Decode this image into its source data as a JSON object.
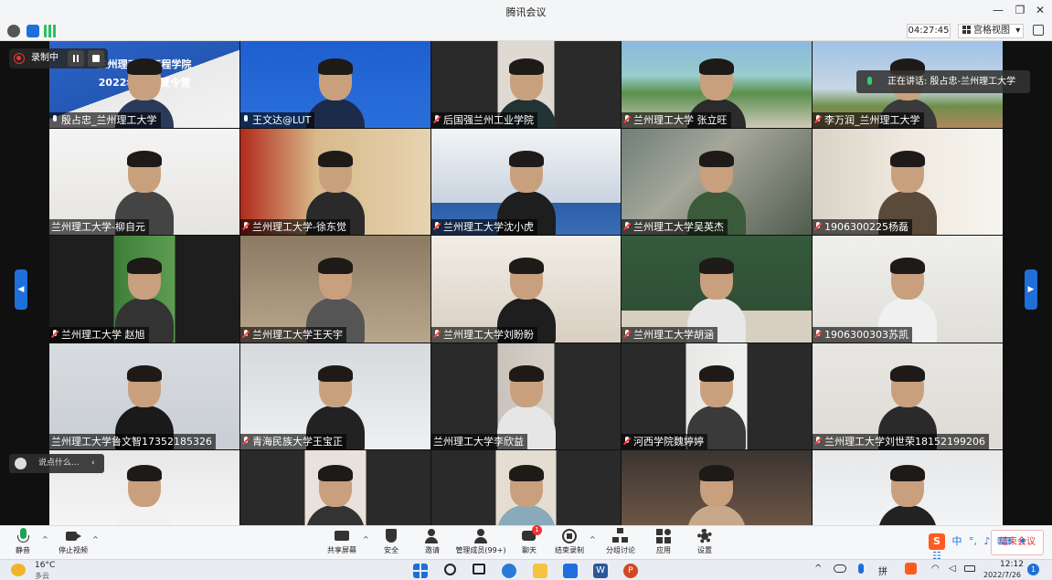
{
  "window": {
    "title": "腾讯会议",
    "minimize": "—",
    "maximize": "❐",
    "close": "✕"
  },
  "topbar": {
    "timer": "04:27:45",
    "view_label": "宫格视图",
    "view_caret": "▾"
  },
  "recording": {
    "label": "录制中"
  },
  "speaking_banner": "正在讲话: 殷占忠-兰州理工大学",
  "chat_input": {
    "placeholder": "说点什么..."
  },
  "participants": [
    {
      "name": "殷占忠_兰州理工大学",
      "mic": "on"
    },
    {
      "name": "王文达@LUT",
      "mic": "on"
    },
    {
      "name": "后国强兰州工业学院",
      "mic": "off"
    },
    {
      "name": "兰州理工大学 张立旺",
      "mic": "off"
    },
    {
      "name": "李万润_兰州理工大学",
      "mic": "off"
    },
    {
      "name": "兰州理工大学-柳自元",
      "mic": "none"
    },
    {
      "name": "兰州理工大学-徐东觉",
      "mic": "off"
    },
    {
      "name": "兰州理工大学沈小虎",
      "mic": "off"
    },
    {
      "name": "兰州理工大学吴英杰",
      "mic": "off"
    },
    {
      "name": "1906300225杨磊",
      "mic": "off"
    },
    {
      "name": "兰州理工大学 赵旭",
      "mic": "off"
    },
    {
      "name": "兰州理工大学王天宇",
      "mic": "off"
    },
    {
      "name": "兰州理工大学刘盼盼",
      "mic": "off"
    },
    {
      "name": "兰州理工大学胡涵",
      "mic": "off"
    },
    {
      "name": "1906300303苏凯",
      "mic": "off"
    },
    {
      "name": "兰州理工大学鲁文智17352185326",
      "mic": "none"
    },
    {
      "name": "青海民族大学王宝正",
      "mic": "off"
    },
    {
      "name": "兰州理工大学李欣益",
      "mic": "none"
    },
    {
      "name": "河西学院魏婷婷",
      "mic": "off"
    },
    {
      "name": "兰州理工大学刘世荣18152199206",
      "mic": "off"
    },
    {
      "name": "",
      "mic": "none"
    },
    {
      "name": "",
      "mic": "none"
    },
    {
      "name": "",
      "mic": "none"
    },
    {
      "name": "",
      "mic": "none"
    },
    {
      "name": "",
      "mic": "none"
    }
  ],
  "banner_slide": {
    "line1": "兰州理工  木工程学院",
    "line2": "2022年  学生夏令营"
  },
  "controls": {
    "mute": "静音",
    "stop_video": "停止视频",
    "share_screen": "共享屏幕",
    "security": "安全",
    "invite": "邀请",
    "manage_members": "管理成员(99+)",
    "chat": "聊天",
    "chat_badge": "1",
    "end_recording": "结束录制",
    "breakout": "分组讨论",
    "apps": "应用",
    "settings": "设置",
    "end_meeting": "结束会议"
  },
  "ime": {
    "logo": "S",
    "lang": "中"
  },
  "taskbar": {
    "weather_temp": "16°C",
    "weather_desc": "多云",
    "time": "12:12",
    "date": "2022/7/26",
    "notif_count": "1"
  }
}
